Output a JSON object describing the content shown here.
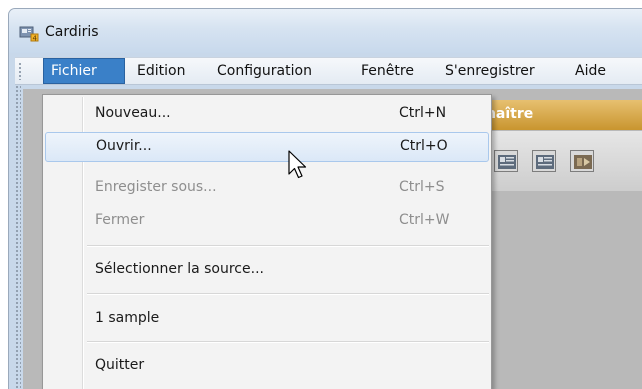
{
  "window": {
    "title": "Cardiris"
  },
  "menubar": {
    "items": [
      {
        "label": "Fichier",
        "active": true
      },
      {
        "label": "Edition"
      },
      {
        "label": "Configuration"
      },
      {
        "label": "Fenêtre"
      },
      {
        "label": "S'enregistrer"
      },
      {
        "label": "Aide"
      }
    ]
  },
  "file_menu": {
    "items": [
      {
        "label": "Nouveau...",
        "shortcut": "Ctrl+N"
      },
      {
        "label": "Ouvrir...",
        "shortcut": "Ctrl+O",
        "highlighted": true
      },
      {
        "label": "Enregister sous...",
        "shortcut": "Ctrl+S",
        "disabled": true
      },
      {
        "label": "Fermer",
        "shortcut": "Ctrl+W",
        "disabled": true
      },
      {
        "label": "Sélectionner la source..."
      },
      {
        "label": "1 sample"
      },
      {
        "label": "Quitter"
      }
    ]
  },
  "background": {
    "banner_text": "nnaître"
  },
  "colors": {
    "menu_active": "#3a80c8",
    "banner": "#d4a13c",
    "content": "#b9b9b9"
  }
}
